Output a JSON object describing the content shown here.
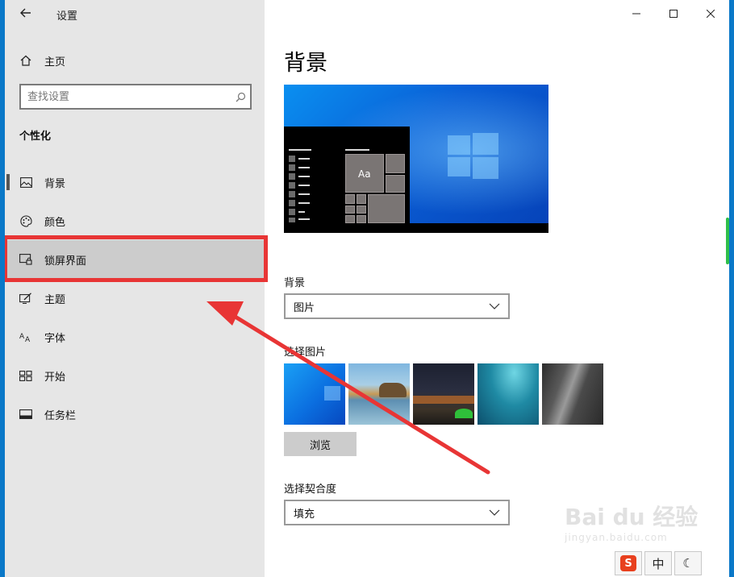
{
  "window": {
    "title": "设置",
    "back_icon": "arrow-left-icon",
    "controls": {
      "minimize": "—",
      "maximize": "☐",
      "close": "✕"
    }
  },
  "sidebar": {
    "home_label": "主页",
    "search_placeholder": "查找设置",
    "section_title": "个性化",
    "items": [
      {
        "label": "背景",
        "icon": "picture-icon"
      },
      {
        "label": "颜色",
        "icon": "palette-icon"
      },
      {
        "label": "锁屏界面",
        "icon": "lock-screen-icon"
      },
      {
        "label": "主题",
        "icon": "theme-icon"
      },
      {
        "label": "字体",
        "icon": "font-icon"
      },
      {
        "label": "开始",
        "icon": "start-icon"
      },
      {
        "label": "任务栏",
        "icon": "taskbar-icon"
      }
    ]
  },
  "main": {
    "page_title": "背景",
    "preview_tile_text": "Aa",
    "background_label": "背景",
    "background_value": "图片",
    "choose_picture_label": "选择图片",
    "browse_label": "浏览",
    "fit_label": "选择契合度",
    "fit_value": "填充"
  },
  "watermark": {
    "brand": "Bai du 经验",
    "sub": "jingyan.baidu.com"
  },
  "tray": {
    "ime_brand": "S",
    "ime_mode": "中",
    "moon": "☾"
  },
  "colors": {
    "accent": "#0a78d7",
    "annotation": "#e83535",
    "sidebar_bg": "#e6e6e6"
  }
}
